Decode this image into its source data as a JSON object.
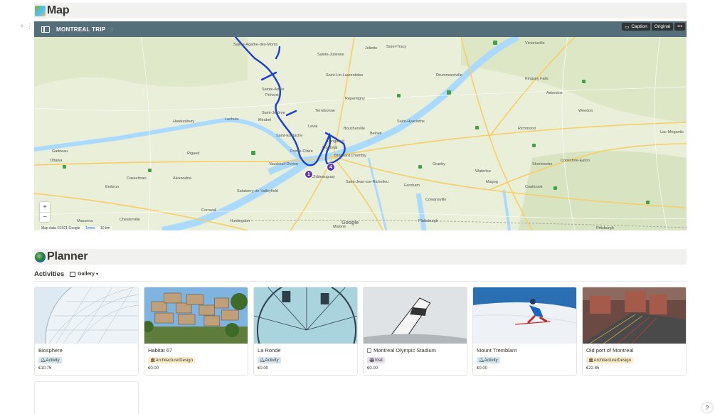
{
  "map_section": {
    "title": "Map",
    "icon": "map-emoji-icon"
  },
  "embed": {
    "title": "MONTREAL TRIP",
    "caption_label": "Caption",
    "original_label": "Original",
    "more_label": "•••",
    "attribution": "Map data ©2021 Google",
    "terms": "Terms",
    "scale": "10 km",
    "google": "Google",
    "zoom_in": "+",
    "zoom_out": "−",
    "pins": [
      "1",
      "4"
    ],
    "places": [
      "Sainte-Agathe-des-Monts",
      "Saint-Jérôme",
      "Laval",
      "Montréal",
      "Longueuil",
      "Boucherville",
      "Terrebonne",
      "Mirabel",
      "Lachute",
      "Hawkesbury",
      "Gatineau",
      "Ottawa",
      "Vaudreuil-Dorion",
      "Salaberry-de-Valleyfield",
      "Cornwall",
      "Saint-Jean-sur-Richelieu",
      "Granby",
      "Sherbrooke",
      "Drummondville",
      "Victoriaville",
      "Saint-Hyacinthe",
      "Chambly",
      "Brossard",
      "Sorel-Tracy",
      "Joliette",
      "Magog",
      "Cowansville",
      "Farnham",
      "Rigaud",
      "Embrun",
      "Casselman",
      "Alexandria",
      "Beloeil",
      "Acton Vale",
      "Waterloo",
      "Bromont",
      "Lac-Brome",
      "Coaticook",
      "Plattsburgh",
      "Huntingdon",
      "Pointe-Claire",
      "Châteauguay",
      "Sainte-Julienne",
      "Sainte-Adèle",
      "Estérel",
      "Repentigny",
      "Berthierville",
      "Yamaska",
      "Nicolet",
      "Windsor",
      "Asbestos",
      "Richmond",
      "Kingsey Falls",
      "Warwick",
      "Weedon",
      "Lac-Mégantic",
      "Cookshire-Eaton",
      "Massena",
      "Malone"
    ]
  },
  "planner_section": {
    "title": "Planner",
    "icon": "globe-emoji-icon"
  },
  "activities": {
    "title": "Activities",
    "view": "Gallery",
    "cards": [
      {
        "name": "Biosphere",
        "tag": "Activity",
        "tag_color": "#d3e5ef",
        "price": "€10.75",
        "thumb": "biosphere"
      },
      {
        "name": "Habitat 67",
        "tag": "Architecture/Design",
        "tag_color": "#fdecc8",
        "price": "€0.00",
        "thumb": "habitat"
      },
      {
        "name": "La Ronde",
        "tag": "Activity",
        "tag_color": "#d3e5ef",
        "price": "€0.00",
        "thumb": "laronde"
      },
      {
        "name": "Montreal Olympic Stadium",
        "tag": "Visit",
        "tag_color": "#e8deee",
        "price": "€0.00",
        "thumb": "stadium"
      },
      {
        "name": "Mount Tremblant",
        "tag": "Activity",
        "tag_color": "#d3e5ef",
        "price": "€0.00",
        "thumb": "tremblant"
      },
      {
        "name": "Old port of Montreal",
        "tag": "Architecture/Design",
        "tag_color": "#fdecc8",
        "price": "€22.85",
        "thumb": "oldport"
      }
    ]
  },
  "help_label": "?"
}
